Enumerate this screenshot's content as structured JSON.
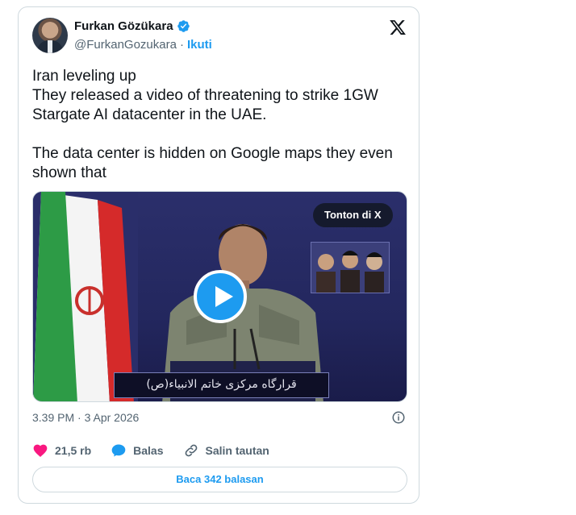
{
  "author": {
    "name": "Furkan Gözükara",
    "handle": "@FurkanGozukara",
    "separator": "·",
    "follow_label": "Ikuti"
  },
  "tweet": {
    "lines_block1": [
      "Iran leveling up",
      "They released a video of threatening to strike 1GW Stargate AI datacenter in the UAE."
    ],
    "line_block2": "The data center is hidden on Google maps they even shown that"
  },
  "media": {
    "watch_label": "Tonton di X",
    "banner_text": "قرارگاه مرکزی خاتم الانبیاء(ص)"
  },
  "meta": {
    "timestamp": "3.39 PM · 3 Apr 2026"
  },
  "actions": {
    "likes": "21,5 rb",
    "reply_label": "Balas",
    "copy_link_label": "Salin tautan"
  },
  "read_replies_label": "Baca 342 balasan",
  "colors": {
    "accent": "#1d9bf0",
    "like": "#f91880",
    "muted": "#536471",
    "border": "#cfd9de"
  },
  "icons": {
    "verified": "verified-badge-icon",
    "x_logo": "x-logo-icon",
    "info": "info-icon",
    "like": "heart-icon",
    "reply": "speech-bubble-icon",
    "copy_link": "link-icon",
    "play": "play-icon"
  }
}
